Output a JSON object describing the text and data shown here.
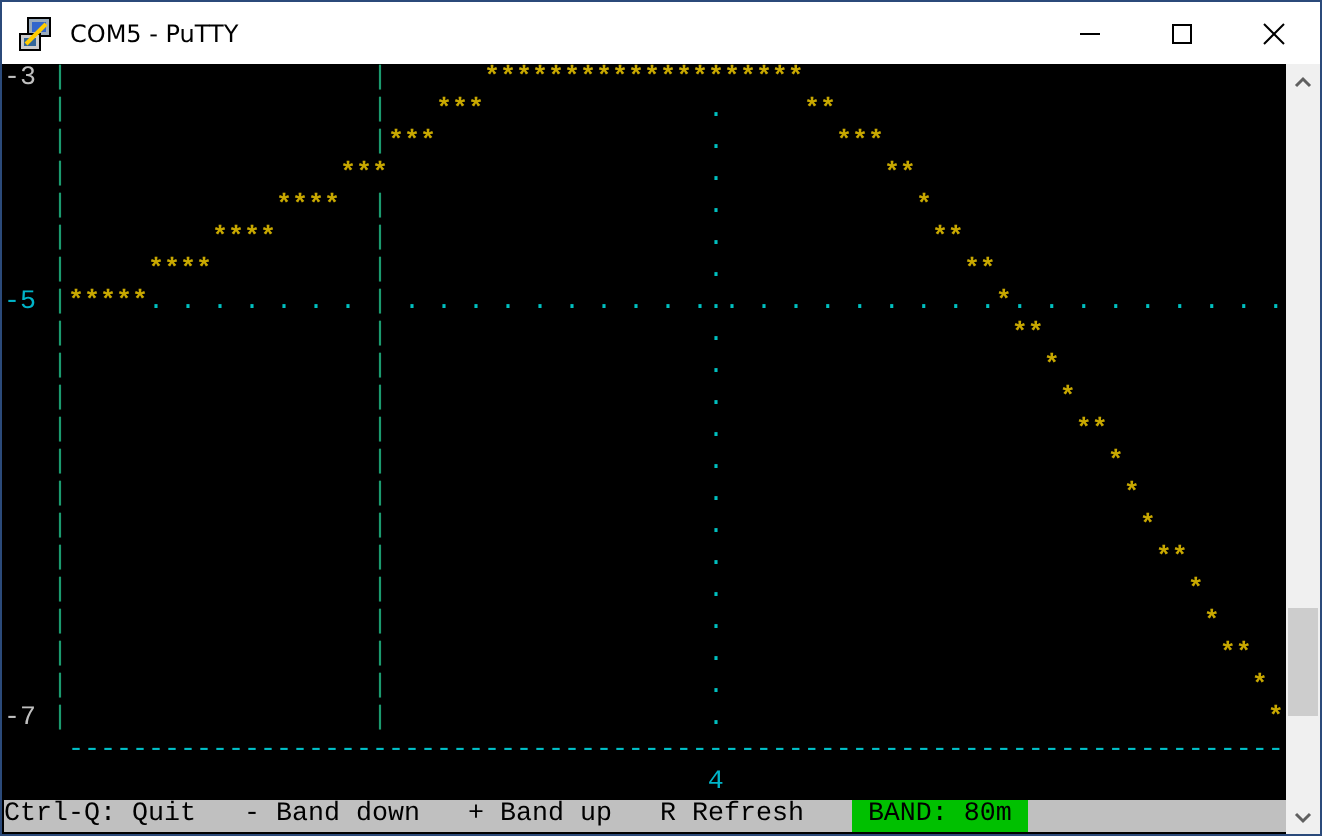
{
  "window": {
    "title": "COM5 - PuTTY"
  },
  "terminal": {
    "rows": [
      {
        "segments": [
          {
            "kind": "label",
            "text": "-3"
          },
          {
            "kind": "axis",
            "text": " |"
          },
          {
            "kind": "axis",
            "text": "                   |"
          },
          {
            "kind": "stars",
            "text": "      ********************"
          }
        ]
      },
      {
        "segments": [
          {
            "kind": "axis",
            "text": "   |"
          },
          {
            "kind": "axis",
            "text": "                   |"
          },
          {
            "kind": "stars",
            "text": "   ***"
          },
          {
            "kind": "dots",
            "text": "              ."
          },
          {
            "kind": "stars",
            "text": "     **"
          }
        ]
      },
      {
        "segments": [
          {
            "kind": "axis",
            "text": "   |"
          },
          {
            "kind": "axis",
            "text": "                   |"
          },
          {
            "kind": "stars",
            "text": "***"
          },
          {
            "kind": "dots",
            "text": "                 ."
          },
          {
            "kind": "stars",
            "text": "       ***"
          }
        ]
      },
      {
        "segments": [
          {
            "kind": "axis",
            "text": "   |"
          },
          {
            "kind": "stars",
            "text": "                 ***"
          },
          {
            "kind": "dots",
            "text": "                    ."
          },
          {
            "kind": "stars",
            "text": "          **"
          }
        ]
      },
      {
        "segments": [
          {
            "kind": "axis",
            "text": "   |"
          },
          {
            "kind": "stars",
            "text": "             ****"
          },
          {
            "kind": "axis",
            "text": "  |"
          },
          {
            "kind": "dots",
            "text": "                    ."
          },
          {
            "kind": "stars",
            "text": "            *"
          }
        ]
      },
      {
        "segments": [
          {
            "kind": "axis",
            "text": "   |"
          },
          {
            "kind": "stars",
            "text": "         ****"
          },
          {
            "kind": "axis",
            "text": "      |"
          },
          {
            "kind": "dots",
            "text": "                    ."
          },
          {
            "kind": "stars",
            "text": "             **"
          }
        ]
      },
      {
        "segments": [
          {
            "kind": "axis",
            "text": "   |"
          },
          {
            "kind": "stars",
            "text": "     ****"
          },
          {
            "kind": "axis",
            "text": "          |"
          },
          {
            "kind": "dots",
            "text": "                    ."
          },
          {
            "kind": "stars",
            "text": "               **"
          }
        ]
      },
      {
        "segments": [
          {
            "kind": "cyan_label",
            "text": "-5"
          },
          {
            "kind": "axis",
            "text": " |"
          },
          {
            "kind": "stars",
            "text": "*****"
          },
          {
            "kind": "dots",
            "text": ". . . . . . ."
          },
          {
            "kind": "axis",
            "text": " |"
          },
          {
            "kind": "dots",
            "text": " . . . . . . . . . ... . . . . . . . ."
          },
          {
            "kind": "stars",
            "text": "*"
          },
          {
            "kind": "dots",
            "text": ". . . . . . . . ."
          }
        ]
      },
      {
        "segments": [
          {
            "kind": "axis",
            "text": "   |"
          },
          {
            "kind": "axis",
            "text": "                   |"
          },
          {
            "kind": "dots",
            "text": "                    ."
          },
          {
            "kind": "stars",
            "text": "                  **"
          }
        ]
      },
      {
        "segments": [
          {
            "kind": "axis",
            "text": "   |"
          },
          {
            "kind": "axis",
            "text": "                   |"
          },
          {
            "kind": "dots",
            "text": "                    ."
          },
          {
            "kind": "stars",
            "text": "                    *"
          }
        ]
      },
      {
        "segments": [
          {
            "kind": "axis",
            "text": "   |"
          },
          {
            "kind": "axis",
            "text": "                   |"
          },
          {
            "kind": "dots",
            "text": "                    ."
          },
          {
            "kind": "stars",
            "text": "                     *"
          }
        ]
      },
      {
        "segments": [
          {
            "kind": "axis",
            "text": "   |"
          },
          {
            "kind": "axis",
            "text": "                   |"
          },
          {
            "kind": "dots",
            "text": "                    ."
          },
          {
            "kind": "stars",
            "text": "                      **"
          }
        ]
      },
      {
        "segments": [
          {
            "kind": "axis",
            "text": "   |"
          },
          {
            "kind": "axis",
            "text": "                   |"
          },
          {
            "kind": "dots",
            "text": "                    ."
          },
          {
            "kind": "stars",
            "text": "                        *"
          }
        ]
      },
      {
        "segments": [
          {
            "kind": "axis",
            "text": "   |"
          },
          {
            "kind": "axis",
            "text": "                   |"
          },
          {
            "kind": "dots",
            "text": "                    ."
          },
          {
            "kind": "stars",
            "text": "                         *"
          }
        ]
      },
      {
        "segments": [
          {
            "kind": "axis",
            "text": "   |"
          },
          {
            "kind": "axis",
            "text": "                   |"
          },
          {
            "kind": "dots",
            "text": "                    ."
          },
          {
            "kind": "stars",
            "text": "                          *"
          }
        ]
      },
      {
        "segments": [
          {
            "kind": "axis",
            "text": "   |"
          },
          {
            "kind": "axis",
            "text": "                   |"
          },
          {
            "kind": "dots",
            "text": "                    ."
          },
          {
            "kind": "stars",
            "text": "                           **"
          }
        ]
      },
      {
        "segments": [
          {
            "kind": "axis",
            "text": "   |"
          },
          {
            "kind": "axis",
            "text": "                   |"
          },
          {
            "kind": "dots",
            "text": "                    ."
          },
          {
            "kind": "stars",
            "text": "                             *"
          }
        ]
      },
      {
        "segments": [
          {
            "kind": "axis",
            "text": "   |"
          },
          {
            "kind": "axis",
            "text": "                   |"
          },
          {
            "kind": "dots",
            "text": "                    ."
          },
          {
            "kind": "stars",
            "text": "                              *"
          }
        ]
      },
      {
        "segments": [
          {
            "kind": "axis",
            "text": "   |"
          },
          {
            "kind": "axis",
            "text": "                   |"
          },
          {
            "kind": "dots",
            "text": "                    ."
          },
          {
            "kind": "stars",
            "text": "                               **"
          }
        ]
      },
      {
        "segments": [
          {
            "kind": "axis",
            "text": "   |"
          },
          {
            "kind": "axis",
            "text": "                   |"
          },
          {
            "kind": "dots",
            "text": "                    ."
          },
          {
            "kind": "stars",
            "text": "                                 *"
          }
        ]
      },
      {
        "segments": [
          {
            "kind": "label",
            "text": "-7"
          },
          {
            "kind": "axis",
            "text": " |"
          },
          {
            "kind": "axis",
            "text": "                   |"
          },
          {
            "kind": "dots",
            "text": "                    ."
          },
          {
            "kind": "stars",
            "text": "                                  *"
          }
        ]
      },
      {
        "segments": [
          {
            "kind": "dashes",
            "text": "    ----------------------------------------------------------------------------"
          }
        ]
      },
      {
        "segments": [
          {
            "kind": "cyan_label",
            "text": "                                            4"
          }
        ]
      }
    ]
  },
  "status_bar": {
    "items": [
      "Ctrl-Q: Quit",
      "- Band down",
      "+ Band up",
      "R Refresh"
    ],
    "band": "BAND: 80m"
  }
}
